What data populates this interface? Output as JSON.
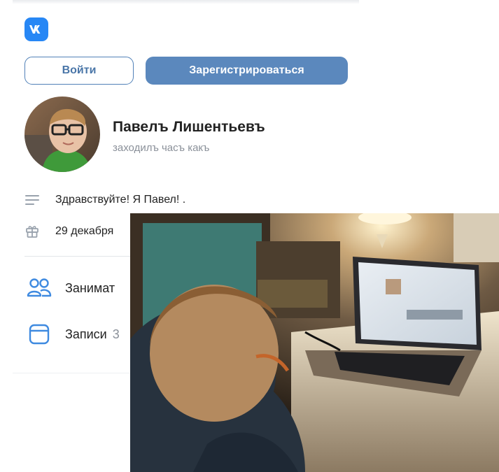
{
  "app": {
    "logo": "vk-logo"
  },
  "auth": {
    "login_label": "Войти",
    "register_label": "Зарегистрироваться"
  },
  "profile": {
    "name": "Павелъ Лишентьевъ",
    "status": "заходилъ часъ какъ",
    "avatar": "avatar-photo-boy-glasses"
  },
  "info": [
    {
      "icon": "text-lines-icon",
      "text": "Здравствуйте! Я Павел! ."
    },
    {
      "icon": "gift-icon",
      "text": "29 декабря"
    }
  ],
  "nav": [
    {
      "icon": "friends-icon",
      "label": "Занимат"
    },
    {
      "icon": "posts-icon",
      "label": "Записи",
      "count": "3"
    }
  ],
  "colors": {
    "accent": "#2787f5",
    "button": "#5b88bd",
    "text": "#222222",
    "muted": "#8a9099"
  },
  "photo": {
    "subject": "boy-at-laptop-photo"
  }
}
